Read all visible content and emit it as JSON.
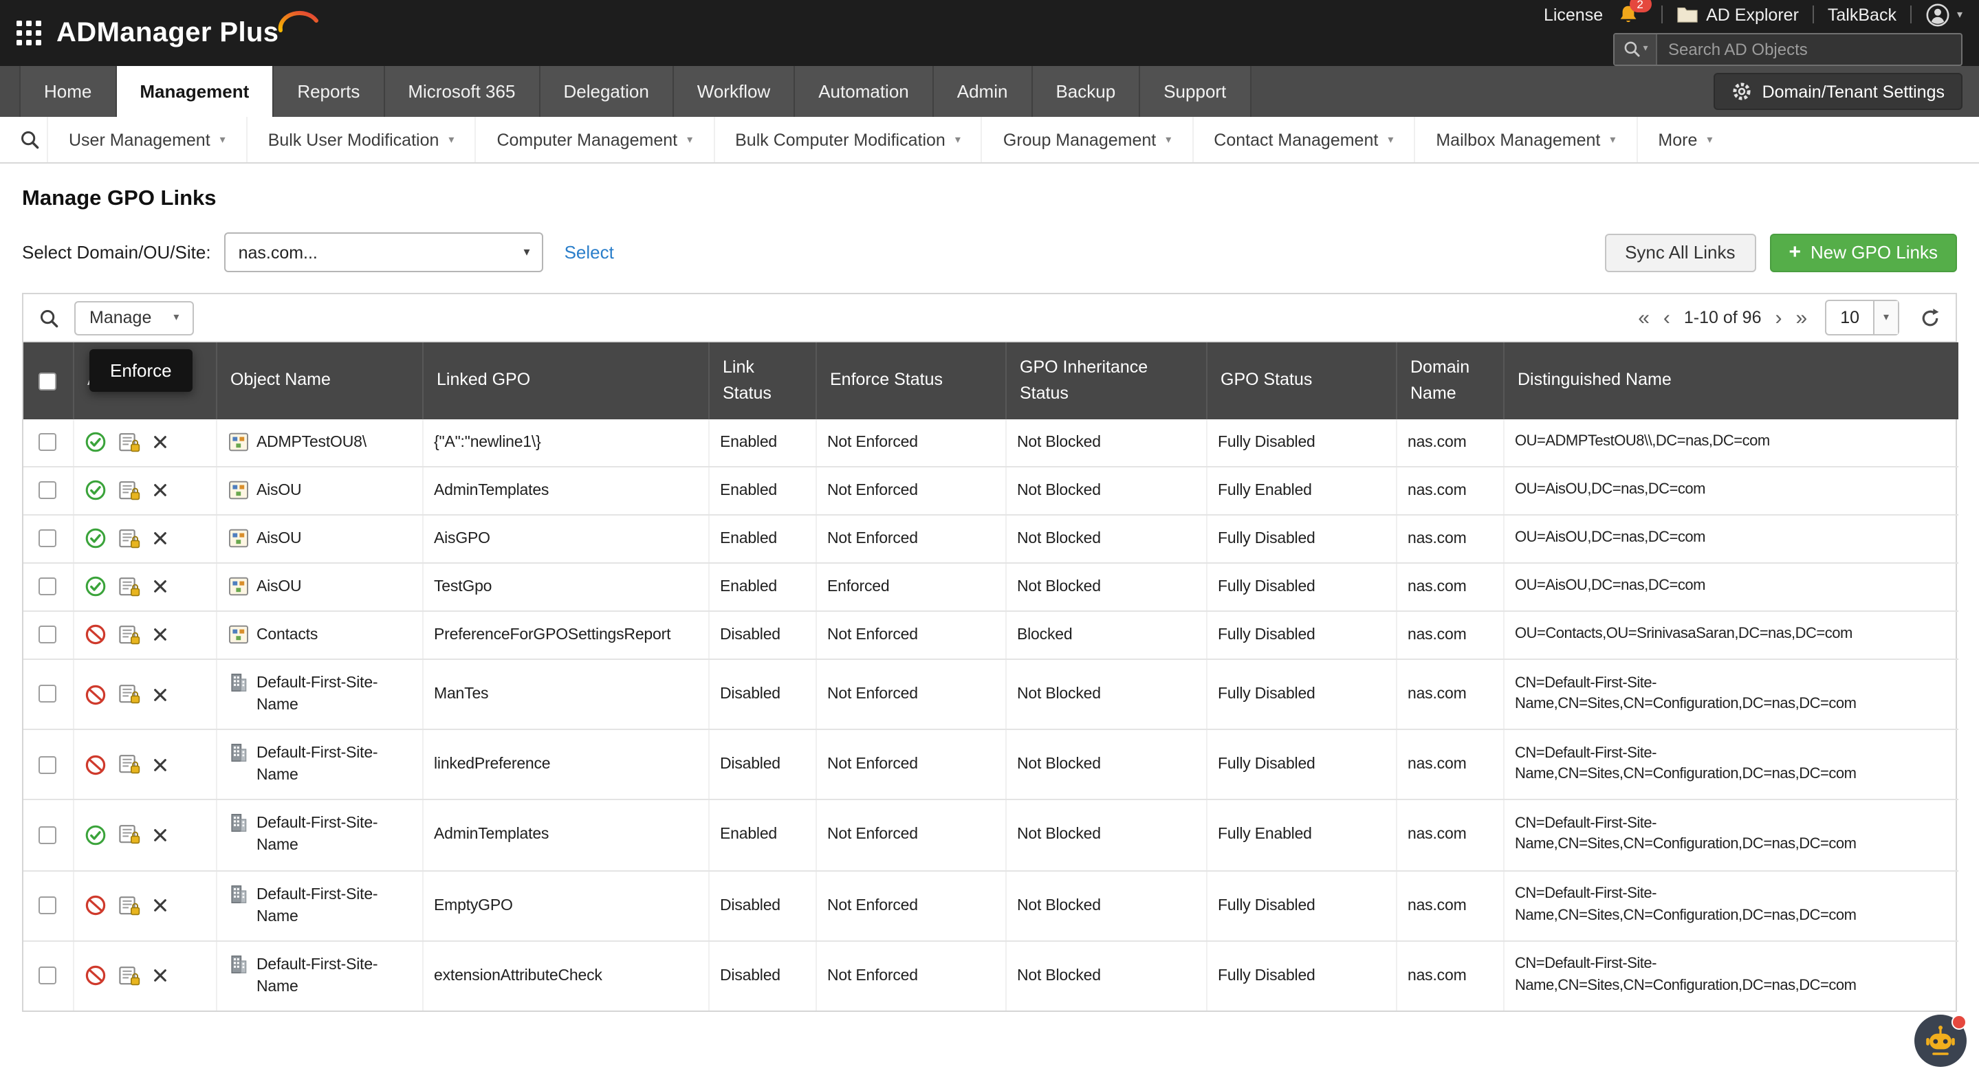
{
  "topbar": {
    "brand": "ADManager Plus",
    "license_label": "License",
    "notification_count": "2",
    "ad_explorer_label": "AD Explorer",
    "talkback_label": "TalkBack",
    "search_placeholder": "Search AD Objects"
  },
  "tabs": {
    "items": [
      "Home",
      "Management",
      "Reports",
      "Microsoft 365",
      "Delegation",
      "Workflow",
      "Automation",
      "Admin",
      "Backup",
      "Support"
    ],
    "active": "Management",
    "settings_button": "Domain/Tenant Settings"
  },
  "subnav": {
    "items": [
      "User Management",
      "Bulk User Modification",
      "Computer Management",
      "Bulk Computer Modification",
      "Group Management",
      "Contact Management",
      "Mailbox Management",
      "More"
    ]
  },
  "page": {
    "title": "Manage GPO Links",
    "domain_label": "Select Domain/OU/Site:",
    "domain_value": "nas.com...",
    "select_link": "Select",
    "sync_button": "Sync All Links",
    "new_button": "New GPO Links"
  },
  "toolbar": {
    "manage_label": "Manage",
    "page_size": "10",
    "pager": {
      "first": "«",
      "prev": "‹",
      "label": "1-10 of 96",
      "next": "›",
      "last": "»"
    }
  },
  "tooltip": {
    "text": "Enforce"
  },
  "table": {
    "headers": [
      "Actions",
      "Object Name",
      "Linked GPO",
      "Link Status",
      "Enforce Status",
      "GPO Inheritance Status",
      "GPO Status",
      "Domain Name",
      "Distinguished Name"
    ],
    "rows": [
      {
        "link_enabled": true,
        "object_icon": "ou",
        "object_name": "ADMPTestOU8\\",
        "linked_gpo": "{\"A\":\"newline1\\}",
        "link_status": "Enabled",
        "enforce_status": "Not Enforced",
        "inheritance_status": "Not Blocked",
        "gpo_status": "Fully Disabled",
        "domain_name": "nas.com",
        "distinguished_name": "OU=ADMPTestOU8\\\\,DC=nas,DC=com"
      },
      {
        "link_enabled": true,
        "object_icon": "ou",
        "object_name": "AisOU",
        "linked_gpo": "AdminTemplates",
        "link_status": "Enabled",
        "enforce_status": "Not Enforced",
        "inheritance_status": "Not Blocked",
        "gpo_status": "Fully Enabled",
        "domain_name": "nas.com",
        "distinguished_name": "OU=AisOU,DC=nas,DC=com"
      },
      {
        "link_enabled": true,
        "object_icon": "ou",
        "object_name": "AisOU",
        "linked_gpo": "AisGPO",
        "link_status": "Enabled",
        "enforce_status": "Not Enforced",
        "inheritance_status": "Not Blocked",
        "gpo_status": "Fully Disabled",
        "domain_name": "nas.com",
        "distinguished_name": "OU=AisOU,DC=nas,DC=com"
      },
      {
        "link_enabled": true,
        "object_icon": "ou",
        "object_name": "AisOU",
        "linked_gpo": "TestGpo",
        "link_status": "Enabled",
        "enforce_status": "Enforced",
        "inheritance_status": "Not Blocked",
        "gpo_status": "Fully Disabled",
        "domain_name": "nas.com",
        "distinguished_name": "OU=AisOU,DC=nas,DC=com"
      },
      {
        "link_enabled": false,
        "object_icon": "ou",
        "object_name": "Contacts",
        "linked_gpo": "PreferenceForGPOSettingsReport",
        "link_status": "Disabled",
        "enforce_status": "Not Enforced",
        "inheritance_status": "Blocked",
        "gpo_status": "Fully Disabled",
        "domain_name": "nas.com",
        "distinguished_name": "OU=Contacts,OU=SrinivasaSaran,DC=nas,DC=com"
      },
      {
        "link_enabled": false,
        "object_icon": "site",
        "object_name": "Default-First-Site-Name",
        "linked_gpo": "ManTes",
        "link_status": "Disabled",
        "enforce_status": "Not Enforced",
        "inheritance_status": "Not Blocked",
        "gpo_status": "Fully Disabled",
        "domain_name": "nas.com",
        "distinguished_name": "CN=Default-First-Site-Name,CN=Sites,CN=Configuration,DC=nas,DC=com"
      },
      {
        "link_enabled": false,
        "object_icon": "site",
        "object_name": "Default-First-Site-Name",
        "linked_gpo": "linkedPreference",
        "link_status": "Disabled",
        "enforce_status": "Not Enforced",
        "inheritance_status": "Not Blocked",
        "gpo_status": "Fully Disabled",
        "domain_name": "nas.com",
        "distinguished_name": "CN=Default-First-Site-Name,CN=Sites,CN=Configuration,DC=nas,DC=com"
      },
      {
        "link_enabled": true,
        "object_icon": "site",
        "object_name": "Default-First-Site-Name",
        "linked_gpo": "AdminTemplates",
        "link_status": "Enabled",
        "enforce_status": "Not Enforced",
        "inheritance_status": "Not Blocked",
        "gpo_status": "Fully Enabled",
        "domain_name": "nas.com",
        "distinguished_name": "CN=Default-First-Site-Name,CN=Sites,CN=Configuration,DC=nas,DC=com"
      },
      {
        "link_enabled": false,
        "object_icon": "site",
        "object_name": "Default-First-Site-Name",
        "linked_gpo": "EmptyGPO",
        "link_status": "Disabled",
        "enforce_status": "Not Enforced",
        "inheritance_status": "Not Blocked",
        "gpo_status": "Fully Disabled",
        "domain_name": "nas.com",
        "distinguished_name": "CN=Default-First-Site-Name,CN=Sites,CN=Configuration,DC=nas,DC=com"
      },
      {
        "link_enabled": false,
        "object_icon": "site",
        "object_name": "Default-First-Site-Name",
        "linked_gpo": "extensionAttributeCheck",
        "link_status": "Disabled",
        "enforce_status": "Not Enforced",
        "inheritance_status": "Not Blocked",
        "gpo_status": "Fully Disabled",
        "domain_name": "nas.com",
        "distinguished_name": "CN=Default-First-Site-Name,CN=Sites,CN=Configuration,DC=nas,DC=com"
      }
    ]
  },
  "colors": {
    "topbar_bg": "#1d1d1d",
    "tabbar_bg": "#4b4b4b",
    "table_header_bg": "#474747",
    "accent_green": "#55ae49",
    "link_blue": "#2a7eca",
    "enabled_green": "#3aa33a",
    "disabled_red": "#cf3a2c",
    "notification_red": "#e5483e",
    "tooltip_bg": "#141414"
  }
}
